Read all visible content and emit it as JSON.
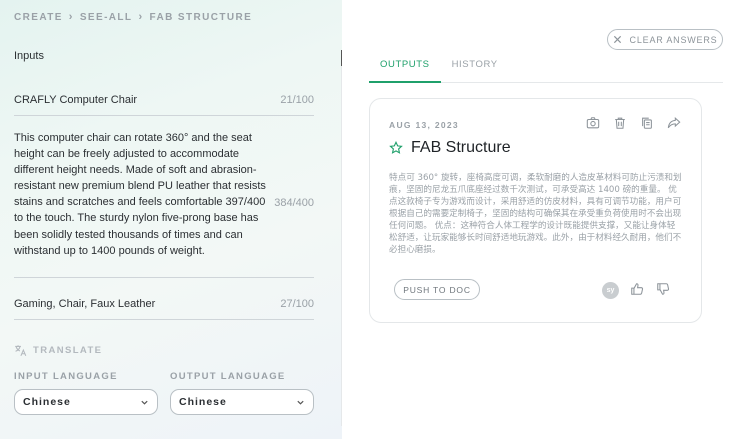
{
  "breadcrumb": [
    "CREATE",
    "SEE-ALL",
    "FAB STRUCTURE"
  ],
  "inputs": {
    "heading": "Inputs",
    "product_name": {
      "value": "CRAFLY Computer Chair",
      "count": "21/100"
    },
    "description": {
      "value": "This computer chair can rotate 360° and the seat height can be freely adjusted to accommodate different height needs. Made of soft and abrasion- resistant new premium blend PU leather that resists stains and scratches and feels comfortable 397/400 to the touch. The sturdy nylon five-prong base has been solidly tested thousands of times and can withstand up to 1400 pounds of weight.",
      "count": "384/400"
    },
    "keywords": {
      "value": "Gaming, Chair, Faux Leather",
      "count": "27/100"
    }
  },
  "translate": {
    "label": "TRANSLATE",
    "input_language_label": "INPUT LANGUAGE",
    "output_language_label": "OUTPUT LANGUAGE",
    "input_language": "Chinese",
    "output_language": "Chinese"
  },
  "clear_answers_label": "CLEAR ANSWERS",
  "tabs": [
    {
      "label": "OUTPUTS",
      "active": true
    },
    {
      "label": "HISTORY",
      "active": false
    }
  ],
  "output_card": {
    "date": "AUG 13, 2023",
    "title": "FAB Structure",
    "body": "特点可 360° 旋转，座椅高度可调，柔软耐磨的人造皮革材料可防止污渍和划痕，坚固的尼龙五爪底座经过数千次测试，可承受高达 1400 磅的重量。 优点这款椅子专为游戏而设计，采用舒适的仿皮材料，具有可调节功能，用户可根据自己的需要定制椅子，坚固的结构可确保其在承受重负荷使用时不会出现任何问题。 优点：这种符合人体工程学的设计既能提供支撑，又能让身体轻松舒适，让玩家能够长时间舒适地玩游戏。此外，由于材料经久耐用，他们不必担心磨损。",
    "push_label": "PUSH TO DOC",
    "avatar_initials": "sy"
  },
  "colors": {
    "accent": "#1fa06b",
    "muted_text": "#9aa1a7",
    "border": "#b9c0c5"
  },
  "icons": [
    "camera-icon",
    "trash-icon",
    "copy-icon",
    "share-icon",
    "star-icon",
    "thumbs-up-icon",
    "thumbs-down-icon",
    "translate-icon",
    "chevron-down-icon",
    "close-icon",
    "chevron-right-icon"
  ]
}
